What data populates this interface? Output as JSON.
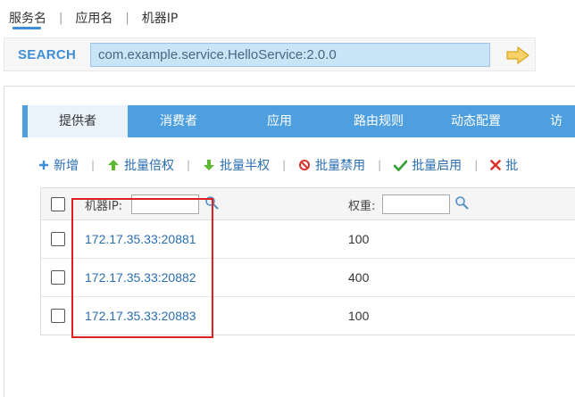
{
  "search_tabs": [
    {
      "label": "服务名"
    },
    {
      "label": "应用名"
    },
    {
      "label": "机器IP"
    }
  ],
  "search": {
    "label": "SEARCH",
    "value": "com.example.service.HelloService:2.0.0"
  },
  "nav_tabs": [
    {
      "label": "提供者"
    },
    {
      "label": "消费者"
    },
    {
      "label": "应用"
    },
    {
      "label": "路由规则"
    },
    {
      "label": "动态配置"
    },
    {
      "label": "访"
    }
  ],
  "toolbar": [
    {
      "label": "新增",
      "icon": "plus-icon"
    },
    {
      "label": "批量倍权",
      "icon": "arrow-up-icon"
    },
    {
      "label": "批量半权",
      "icon": "arrow-down-icon"
    },
    {
      "label": "批量禁用",
      "icon": "disable-icon"
    },
    {
      "label": "批量启用",
      "icon": "check-icon"
    },
    {
      "label": "批",
      "icon": "close-icon"
    }
  ],
  "table": {
    "col_ip": "机器IP:",
    "col_weight": "权重:",
    "rows": [
      {
        "address": "172.17.35.33:20881",
        "weight": "100"
      },
      {
        "address": "172.17.35.33:20882",
        "weight": "400"
      },
      {
        "address": "172.17.35.33:20883",
        "weight": "100"
      }
    ]
  },
  "colors": {
    "accent": "#4d9fe0",
    "link": "#2a6eb2",
    "highlight": "#e02020"
  }
}
